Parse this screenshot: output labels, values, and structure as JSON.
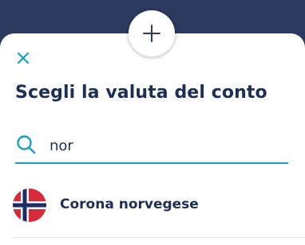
{
  "sheet": {
    "title": "Scegli la valuta del conto",
    "close_icon": "close-icon",
    "add_icon": "plus-icon"
  },
  "search": {
    "value": "nor",
    "icon": "search-icon"
  },
  "results": [
    {
      "label": "Corona norvegese",
      "flag": "norway-flag-icon"
    }
  ],
  "colors": {
    "brand_navy": "#1b2f57",
    "accent_teal": "#1a9ec2",
    "backdrop": "#2b3b60"
  }
}
